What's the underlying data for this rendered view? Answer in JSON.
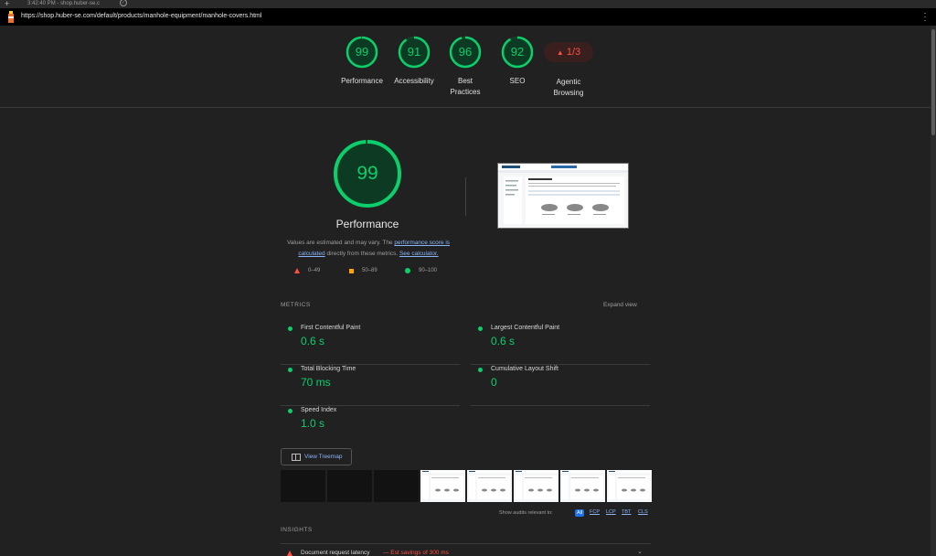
{
  "tab": {
    "title": "3:42:40 PM - shop.huber-se.c"
  },
  "browser": {
    "url": "https://shop.huber-se.com/default/products/manhole-equipment/manhole-covers.html"
  },
  "summary": {
    "categories": [
      {
        "label": "Performance",
        "score": "99"
      },
      {
        "label": "Accessibility",
        "score": "91"
      },
      {
        "label": "Best Practices",
        "score": "96"
      },
      {
        "label": "SEO",
        "score": "92"
      }
    ],
    "agentic": {
      "label": "Agentic Browsing",
      "badge": "1/3"
    },
    "score_fraction": [
      0.99,
      0.91,
      0.96,
      0.92
    ]
  },
  "performance": {
    "score": "99",
    "score_fraction": 0.99,
    "title": "Performance",
    "desc_pre": "Values are estimated and may vary. The ",
    "desc_link1": "performance score is calculated",
    "desc_mid": " directly from these metrics. ",
    "desc_link2": "See calculator.",
    "legend": {
      "poor": "0–49",
      "average": "50–89",
      "good": "90–100"
    }
  },
  "metrics": {
    "heading": "METRICS",
    "expand": "Expand view",
    "items": [
      {
        "name": "First Contentful Paint",
        "value": "0.6 s"
      },
      {
        "name": "Largest Contentful Paint",
        "value": "0.6 s"
      },
      {
        "name": "Total Blocking Time",
        "value": "70 ms"
      },
      {
        "name": "Cumulative Layout Shift",
        "value": "0"
      },
      {
        "name": "Speed Index",
        "value": "1.0 s"
      }
    ]
  },
  "treemap": {
    "label": "View Treemap"
  },
  "relevant": {
    "label": "Show audits relevant to:",
    "chips": [
      "All",
      "FCP",
      "LCP",
      "TBT",
      "CLS"
    ]
  },
  "insights": {
    "heading": "INSIGHTS",
    "first": {
      "name": "Document request latency",
      "estimate": "— Est savings of 300 ms"
    }
  },
  "colors": {
    "good": "#0cce6b",
    "average": "#ffa400",
    "poor": "#ff4e42",
    "link": "#8ab4f8"
  }
}
